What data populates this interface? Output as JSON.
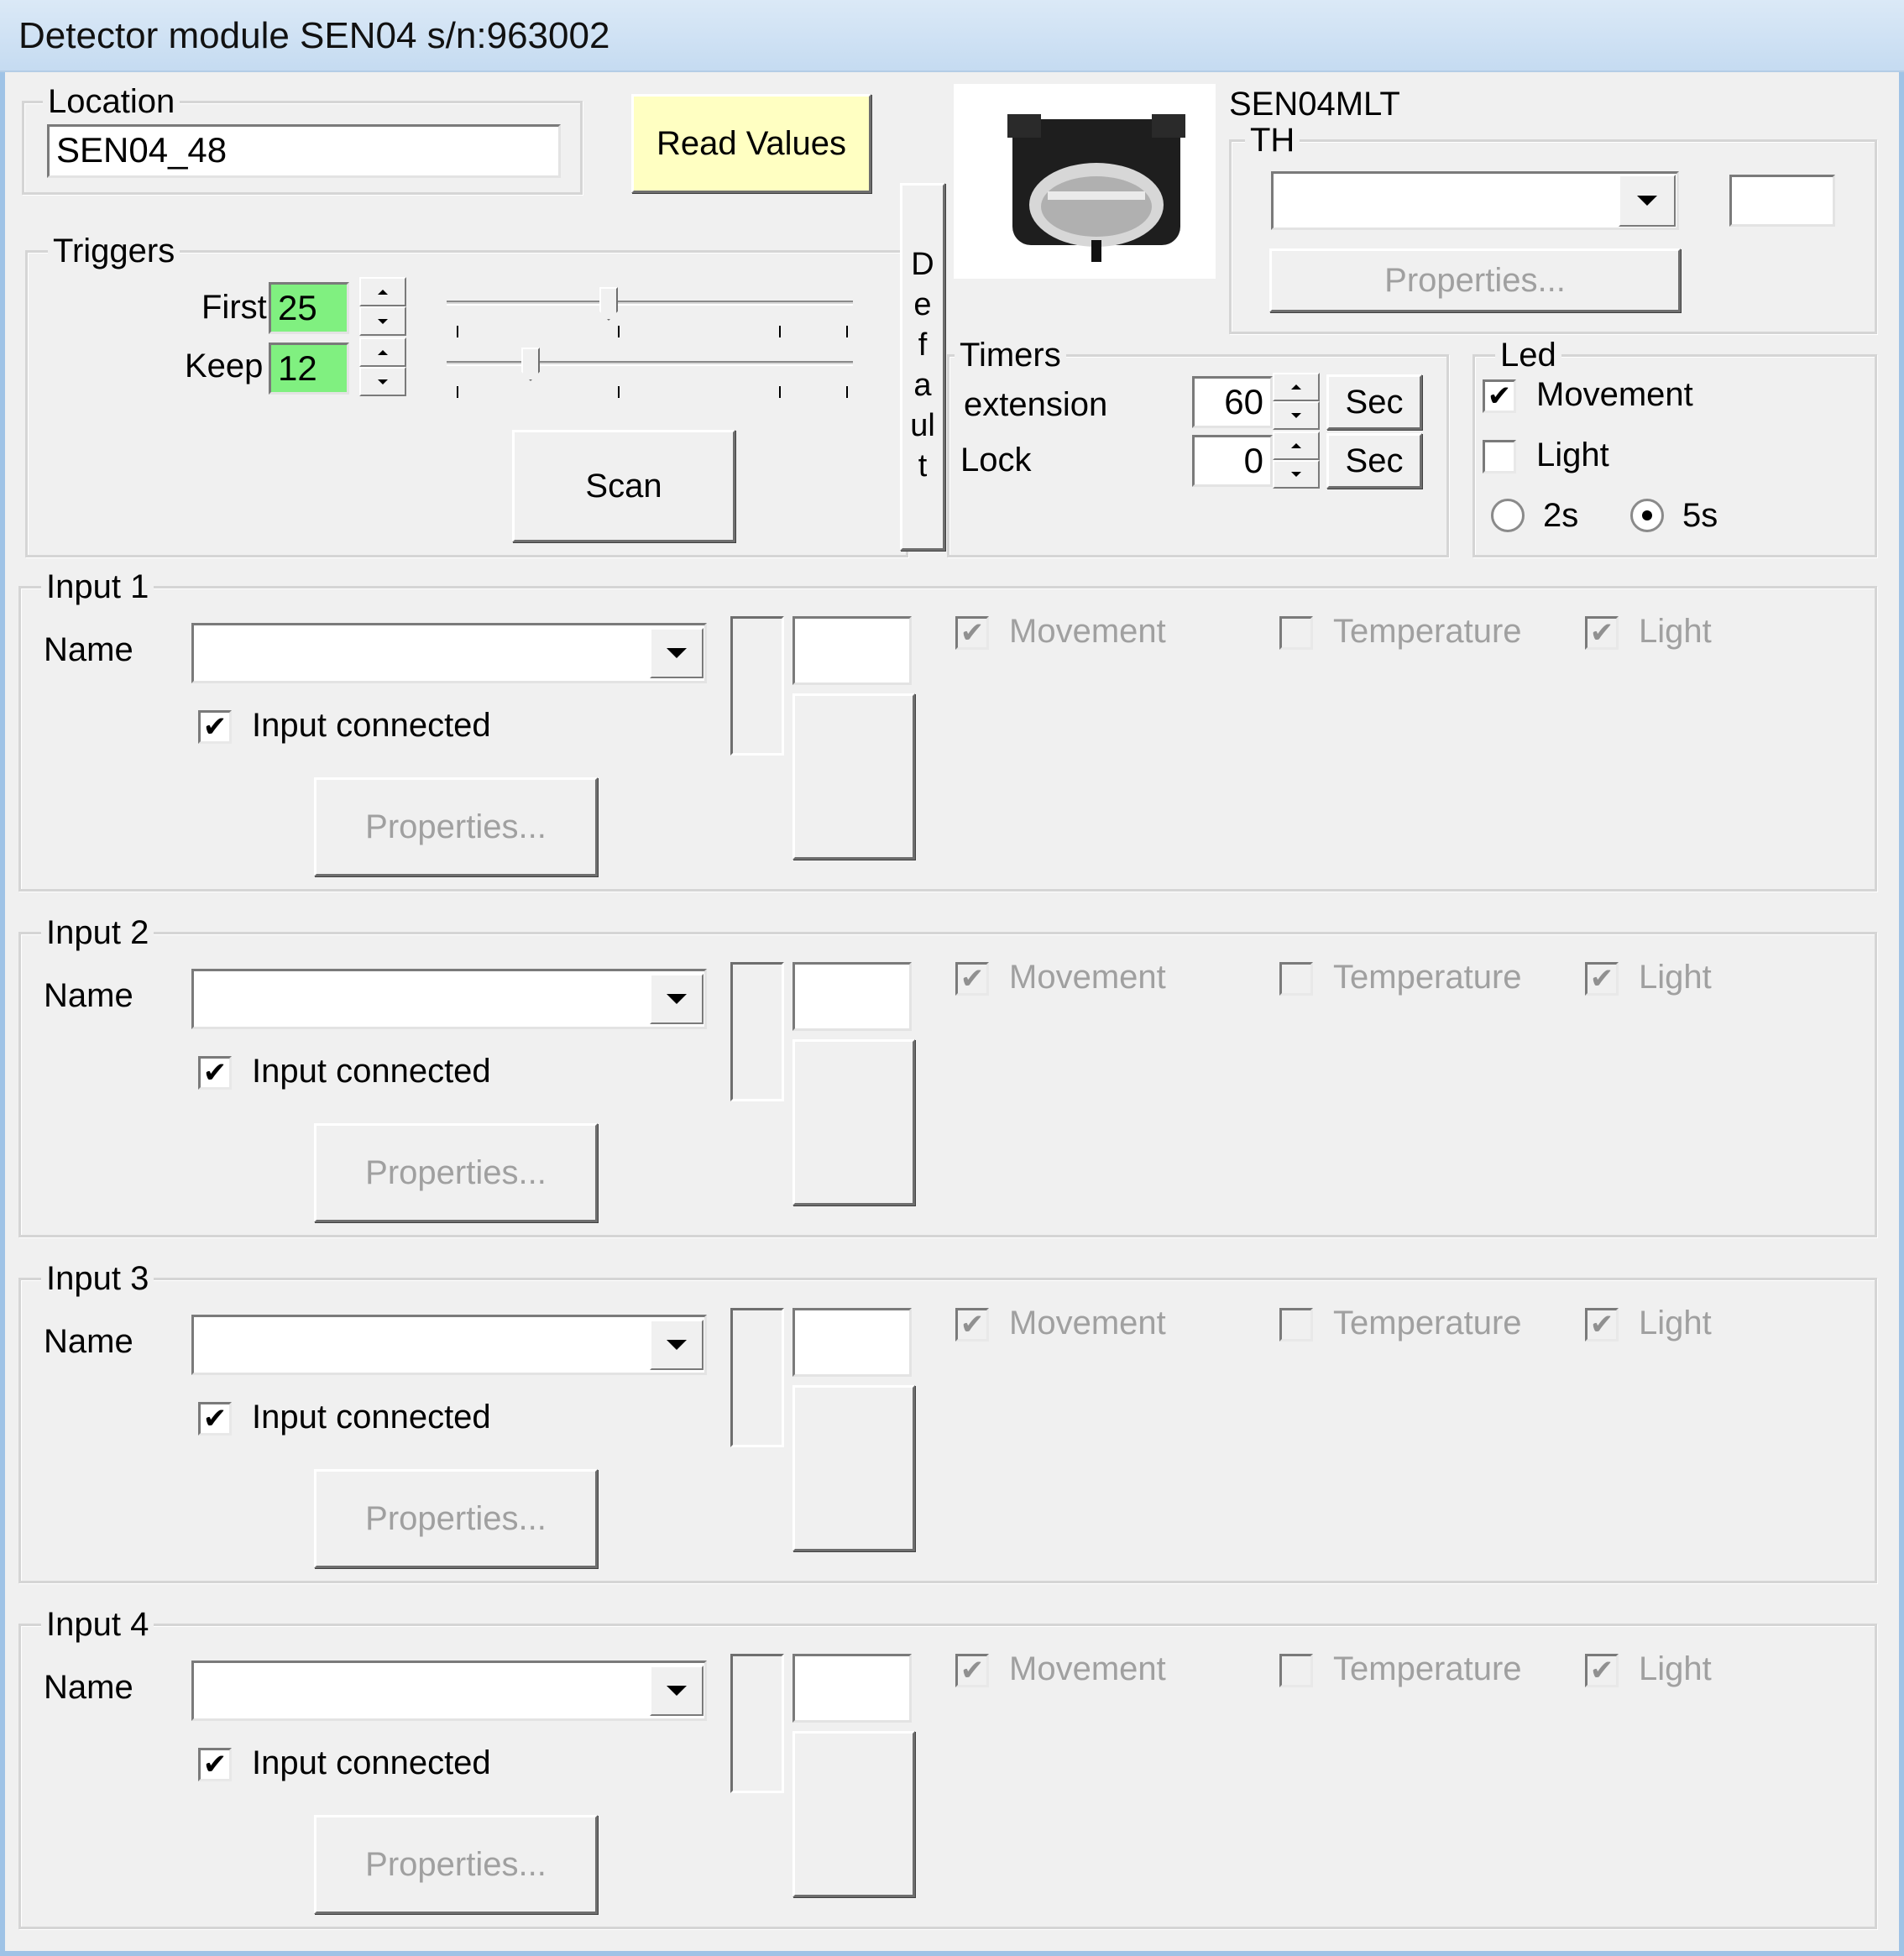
{
  "window": {
    "title": "Detector module SEN04 s/n:963002"
  },
  "location": {
    "legend": "Location",
    "value": "SEN04_48"
  },
  "read_values_label": "Read Values",
  "model_label": "SEN04MLT",
  "th": {
    "legend": "TH",
    "value": "",
    "properties_label": "Properties..."
  },
  "triggers": {
    "legend": "Triggers",
    "first_label": "First",
    "first_value": "25",
    "first_slider_fraction": 0.39,
    "keep_label": "Keep",
    "keep_value": "12",
    "keep_slider_fraction": 0.19,
    "scan_label": "Scan"
  },
  "default_label_chars": [
    "D",
    "e",
    "f",
    "a",
    "ul",
    "t"
  ],
  "timers": {
    "legend": "Timers",
    "extension_label": "extension",
    "extension_value": "60",
    "extension_unit": "Sec",
    "lock_label": "Lock",
    "lock_value": "0",
    "lock_unit": "Sec"
  },
  "led": {
    "legend": "Led",
    "movement_label": "Movement",
    "movement_checked": true,
    "light_label": "Light",
    "light_checked": false,
    "radio_2s_label": "2s",
    "radio_5s_label": "5s",
    "selected": "5s"
  },
  "inputs": [
    {
      "legend": "Input 1",
      "name_label": "Name",
      "name_value": "",
      "connected_label": "Input connected",
      "connected": true,
      "properties_label": "Properties...",
      "movement_label": "Movement",
      "movement": true,
      "temperature_label": "Temperature",
      "temperature": false,
      "light_label": "Light",
      "light": true
    },
    {
      "legend": "Input 2",
      "name_label": "Name",
      "name_value": "",
      "connected_label": "Input connected",
      "connected": true,
      "properties_label": "Properties...",
      "movement_label": "Movement",
      "movement": true,
      "temperature_label": "Temperature",
      "temperature": false,
      "light_label": "Light",
      "light": true
    },
    {
      "legend": "Input 3",
      "name_label": "Name",
      "name_value": "",
      "connected_label": "Input connected",
      "connected": true,
      "properties_label": "Properties...",
      "movement_label": "Movement",
      "movement": true,
      "temperature_label": "Temperature",
      "temperature": false,
      "light_label": "Light",
      "light": true
    },
    {
      "legend": "Input 4",
      "name_label": "Name",
      "name_value": "",
      "connected_label": "Input connected",
      "connected": true,
      "properties_label": "Properties...",
      "movement_label": "Movement",
      "movement": true,
      "temperature_label": "Temperature",
      "temperature": false,
      "light_label": "Light",
      "light": true
    }
  ],
  "colors": {
    "title_bar": "#c5dbf1",
    "field_green": "#80f080",
    "read_values_bg": "#ffffc2",
    "window_bg": "#f0f0f0"
  }
}
